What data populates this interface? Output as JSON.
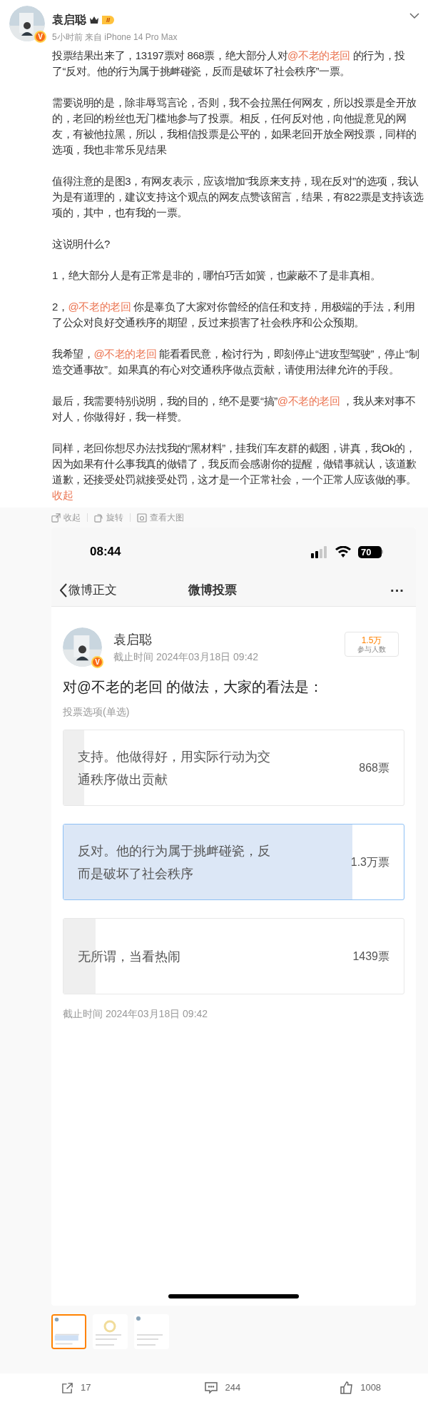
{
  "post": {
    "author": "袁启聪",
    "rank": "II",
    "verified": "V",
    "meta": "5小时前 来自 iPhone 14 Pro Max",
    "paragraphs": [
      [
        {
          "kind": "text",
          "text": "投票结果出来了，13197票对 868票，绝大部分人对"
        },
        {
          "kind": "mention",
          "text": "@不老的老回"
        },
        {
          "kind": "text",
          "text": " 的行为，投了“反对。他的行为属于挑衅碰瓷，反而是破坏了社会秩序”一票。"
        }
      ],
      [
        {
          "kind": "text",
          "text": "需要说明的是，除非辱骂言论，否则，我不会拉黑任何网友，所以投票是全开放的，老回的粉丝也无门槛地参与了投票。相反，任何反对他，向他提意见的网友，有被他拉黑，所以，我相信投票是公平的，如果老回开放全网投票，同样的选项，我也非常乐见结果"
        }
      ],
      [
        {
          "kind": "text",
          "text": "值得注意的是图3，有网友表示，应该增加“我原来支持，现在反对”的选项，我认为是有道理的，建议支持这个观点的网友点赞该留言，结果，有822票是支持该选项的，其中，也有我的一票。"
        }
      ],
      [
        {
          "kind": "text",
          "text": "这说明什么?"
        }
      ],
      [
        {
          "kind": "text",
          "text": "1，绝大部分人是有正常是非的，哪怕巧舌如簧，也蒙蔽不了是非真相。"
        }
      ],
      [
        {
          "kind": "text",
          "text": "2，"
        },
        {
          "kind": "mention",
          "text": "@不老的老回"
        },
        {
          "kind": "text",
          "text": " 你是辜负了大家对你曾经的信任和支持，用极端的手法，利用了公众对良好交通秩序的期望，反过来损害了社会秩序和公众预期。"
        }
      ],
      [
        {
          "kind": "text",
          "text": "我希望，"
        },
        {
          "kind": "mention",
          "text": "@不老的老回"
        },
        {
          "kind": "text",
          "text": " 能看看民意，检讨行为，即刻停止“进攻型驾驶”，停止“制造交通事故”。如果真的有心对交通秩序做点贡献，请使用法律允许的手段。"
        }
      ],
      [
        {
          "kind": "text",
          "text": "最后，我需要特别说明，我的目的，绝不是要“搞”"
        },
        {
          "kind": "mention",
          "text": "@不老的老回"
        },
        {
          "kind": "text",
          "text": " ，我从来对事不对人，你做得好，我一样赞。"
        }
      ],
      [
        {
          "kind": "text",
          "text": "同样，老回你想尽办法找我的“黑材料”，挂我们车友群的截图，讲真，我Ok的，因为如果有什么事我真的做错了，我反而会感谢你的提醒，做错事就认，该道歉道歉，还接受处罚就接受处罚，这才是一个正常社会，一个正常人应该做的事。 "
        },
        {
          "kind": "link",
          "text": "收起"
        }
      ]
    ]
  },
  "image_toolbar": [
    "收起",
    "旋转",
    "查看大图"
  ],
  "screenshot": {
    "time": "08:44",
    "battery": "70",
    "back_label": "微博正文",
    "title": "微博投票",
    "more": "···",
    "poll": {
      "author": "袁启聪",
      "verified": "V",
      "deadline": "截止时间 2024年03月18日 09:42",
      "participants": "1.5万",
      "participants_label": "参与人数",
      "question": "对@不老的老回 的做法，大家的看法是：",
      "type_label": "投票选项(单选)",
      "options": [
        {
          "text": "支持。他做得好，用实际行动为交通秩序做出贡献",
          "votes": "868票",
          "level": 0.06,
          "selected": false
        },
        {
          "text": "反对。他的行为属于挑衅碰瓷，反而是破坏了社会秩序",
          "votes": "1.3万票",
          "level": 0.85,
          "selected": true
        },
        {
          "text": "无所谓，当看热闹",
          "votes": "1439票",
          "level": 0.095,
          "selected": false
        }
      ],
      "footer": "截止时间 2024年03月18日 09:42"
    }
  },
  "thumbnails": [
    {
      "selected": true
    },
    {
      "selected": false
    },
    {
      "selected": false
    }
  ],
  "actions": [
    {
      "kind": "share",
      "count": "17"
    },
    {
      "kind": "comment",
      "count": "244"
    },
    {
      "kind": "like",
      "count": "1008"
    }
  ]
}
